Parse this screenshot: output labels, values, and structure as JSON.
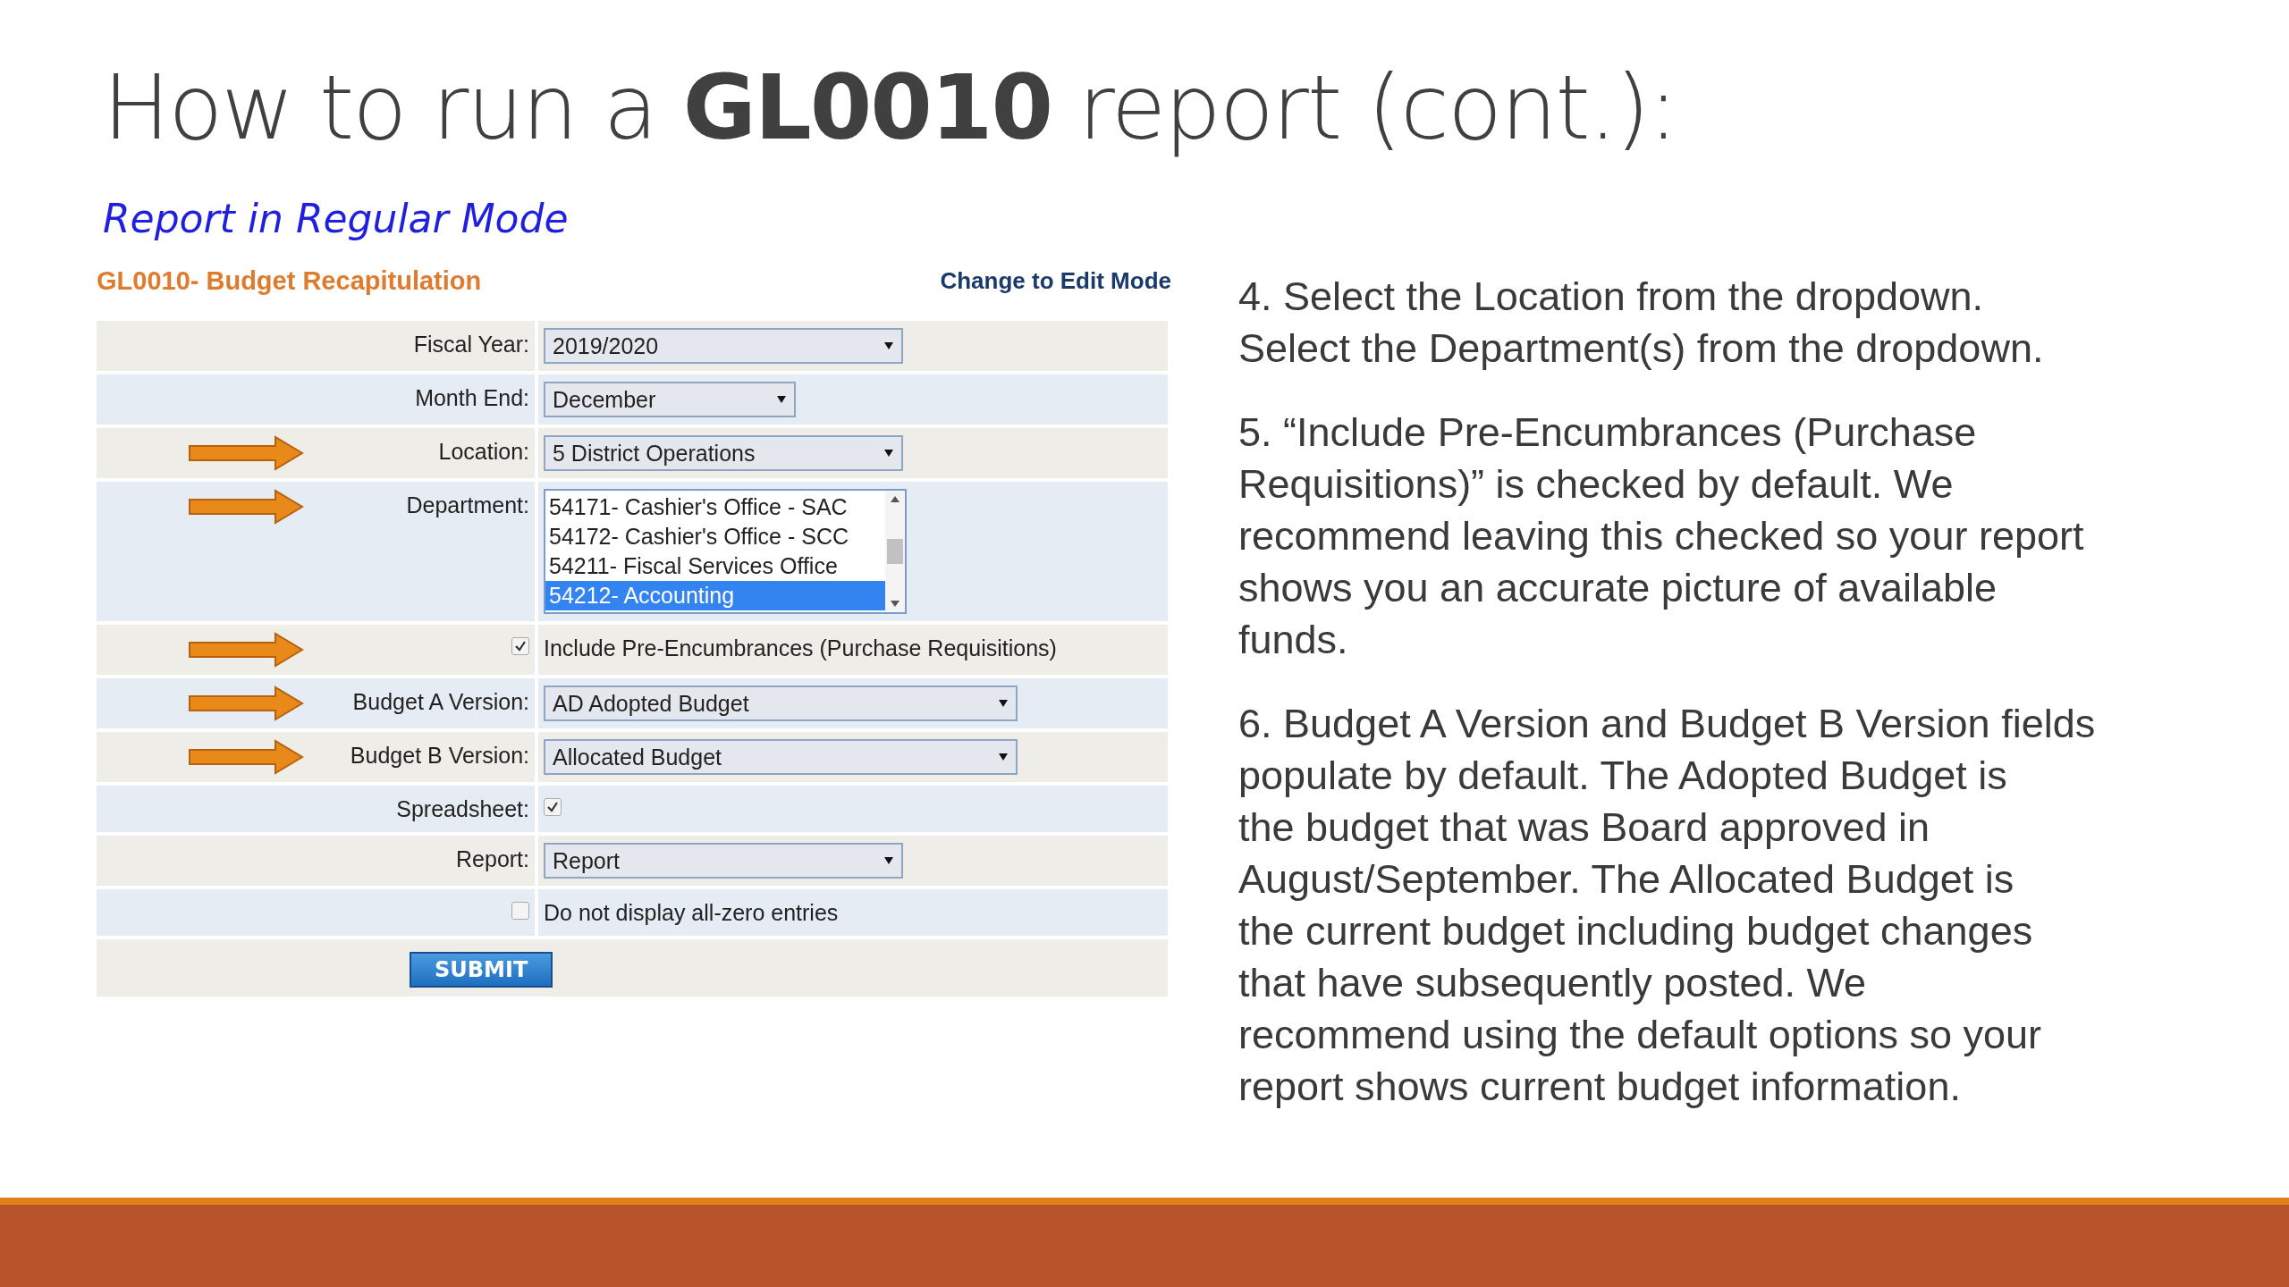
{
  "title": {
    "before": "How to run a ",
    "bold": "GL0010",
    "after": " report (cont.):"
  },
  "subtitle": "Report in Regular Mode",
  "form": {
    "heading": "GL0010- Budget Recapitulation",
    "mode_link": "Change to Edit Mode",
    "rows": [
      {
        "kind": "select",
        "label": "Fiscal Year:",
        "value": "2019/2020",
        "arrow": false
      },
      {
        "kind": "select",
        "label": "Month End:",
        "value": "December",
        "arrow": false
      },
      {
        "kind": "select",
        "label": "Location:",
        "value": "5 District Operations",
        "arrow": true
      },
      {
        "kind": "listbox",
        "label": "Department:",
        "arrow": true,
        "options": [
          {
            "text": "54171- Cashier's Office - SAC",
            "selected": false
          },
          {
            "text": "54172- Cashier's Office - SCC",
            "selected": false
          },
          {
            "text": "54211- Fiscal Services Office",
            "selected": false
          },
          {
            "text": "54212- Accounting",
            "selected": true
          }
        ]
      },
      {
        "kind": "check_option",
        "text": "Include Pre-Encumbrances (Purchase Requisitions)",
        "checked": true,
        "arrow": true
      },
      {
        "kind": "select",
        "label": "Budget A Version:",
        "value": "AD Adopted Budget",
        "arrow": true
      },
      {
        "kind": "select",
        "label": "Budget B Version:",
        "value": "Allocated Budget",
        "arrow": true
      },
      {
        "kind": "checkbox",
        "label": "Spreadsheet:",
        "checked": true,
        "arrow": false
      },
      {
        "kind": "select",
        "label": "Report:",
        "value": "Report",
        "arrow": false
      },
      {
        "kind": "check_option",
        "text": "Do not display all-zero entries",
        "checked": false,
        "arrow": false
      },
      {
        "kind": "submit",
        "text": "SUBMIT",
        "arrow": false
      }
    ]
  },
  "notes": [
    {
      "lines": [
        "4. Select the Location from the dropdown.",
        "Select the Department(s) from the dropdown."
      ]
    },
    {
      "lines": [
        "5. “Include Pre-Encumbrances (Purchase",
        "Requisitions)” is checked by default. We",
        "recommend leaving this checked so your report",
        "shows you an accurate picture of available",
        "funds."
      ]
    },
    {
      "lines": [
        "6. Budget A Version and Budget B Version fields",
        "populate by default.  The Adopted Budget is",
        "the budget that was Board approved in",
        "August/September.  The Allocated Budget is",
        "the current budget including budget changes",
        "that have subsequently posted.  We",
        "recommend using the default options so your",
        "report shows current budget information."
      ]
    }
  ]
}
